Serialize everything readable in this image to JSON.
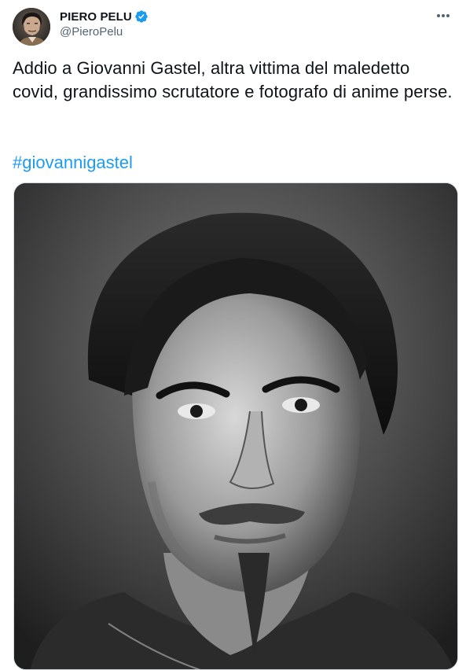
{
  "tweet": {
    "author": {
      "display_name": "PIERO PELU",
      "handle": "@PieroPelu",
      "verified": true,
      "avatar_icon": "profile-photo"
    },
    "more_icon": "more-options-icon",
    "text": "Addio a Giovanni Gastel, altra vittima del maledetto covid, grandissimo scrutatore e fotografo di anime perse.",
    "hashtag": "#giovannigastel",
    "media": {
      "type": "photo",
      "style": "black-and-white portrait"
    }
  },
  "colors": {
    "text": "#0f1419",
    "secondary_text": "#536471",
    "link": "#1d9bf0",
    "verified_badge": "#1d9bf0",
    "border": "#cfd9de"
  }
}
